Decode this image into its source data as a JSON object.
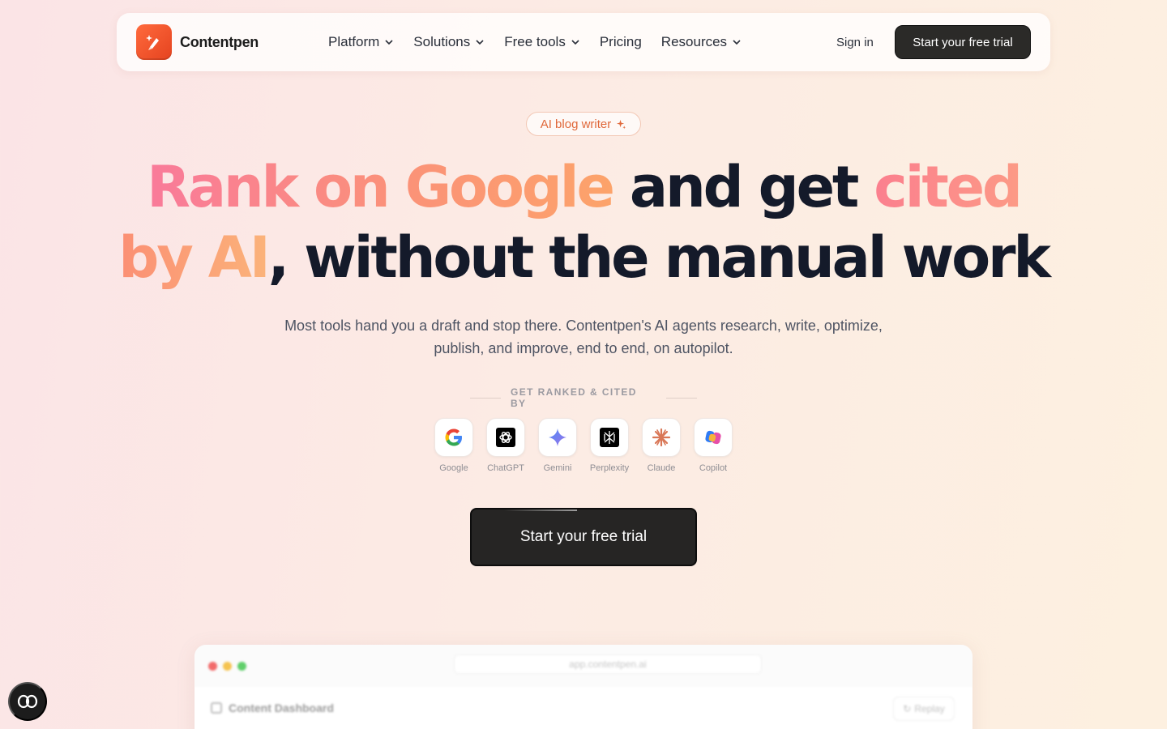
{
  "nav": {
    "brand": "Contentpen",
    "menu": [
      {
        "label": "Platform",
        "has_dropdown": true
      },
      {
        "label": "Solutions",
        "has_dropdown": true
      },
      {
        "label": "Free tools",
        "has_dropdown": true
      },
      {
        "label": "Pricing",
        "has_dropdown": false
      },
      {
        "label": "Resources",
        "has_dropdown": true
      }
    ],
    "sign_in": "Sign in",
    "cta": "Start your free trial"
  },
  "hero": {
    "pill": "AI blog writer",
    "headline": {
      "line1_grad": "Rank on Google",
      "line1_dark": " and get ",
      "line1_grad2": "cited",
      "line2_grad": "by AI",
      "line2_dark": ", without the manual work"
    },
    "subtitle": "Most tools hand you a draft and stop there. Contentpen's AI agents research, write, optimize, publish, and improve, end to end, on autopilot.",
    "cited_label": "GET RANKED & CITED BY",
    "engines": [
      {
        "label": "Google",
        "icon": "google-icon"
      },
      {
        "label": "ChatGPT",
        "icon": "chatgpt-icon"
      },
      {
        "label": "Gemini",
        "icon": "gemini-icon"
      },
      {
        "label": "Perplexity",
        "icon": "perplexity-icon"
      },
      {
        "label": "Claude",
        "icon": "claude-icon"
      },
      {
        "label": "Copilot",
        "icon": "copilot-icon"
      }
    ],
    "cta": "Start your free trial"
  },
  "dashboard": {
    "url": "app.contentpen.ai",
    "title": "Content Dashboard",
    "replay": "Replay"
  },
  "colors": {
    "brand": "#E5431F",
    "dark_button": "#2B2A28",
    "headline_dark": "#141A2A",
    "accent_text": "#E0683A"
  }
}
